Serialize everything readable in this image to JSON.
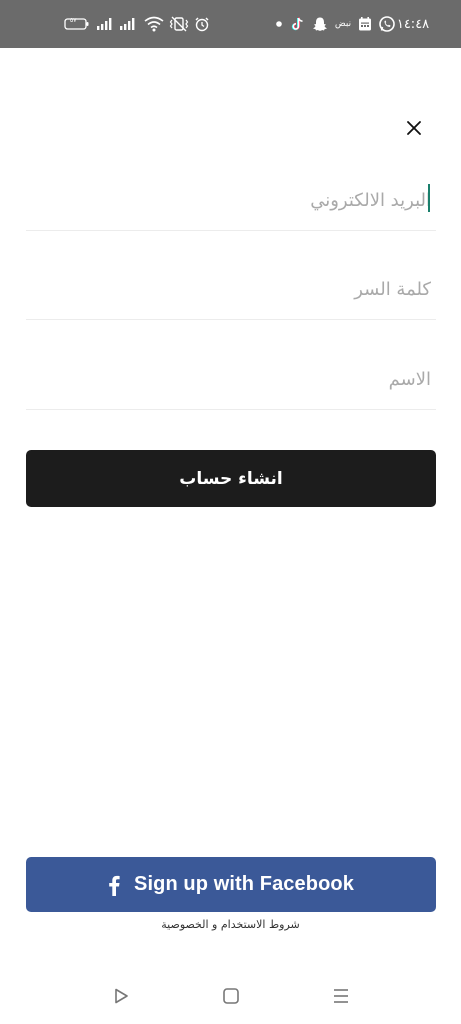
{
  "status_bar": {
    "time": "١٤:٤٨",
    "notification_text": "نبض",
    "battery_level": "٥٧",
    "icons": [
      "battery-icon",
      "signal-bars-icon",
      "signal-bars-icon",
      "wifi-icon",
      "vibrate-icon",
      "alarm-icon",
      "dot-icon",
      "tiktok-icon",
      "snapchat-icon",
      "nabd-icon",
      "calendar-icon",
      "whatsapp-icon"
    ]
  },
  "form": {
    "email_placeholder": "البريد الالكتروني",
    "password_placeholder": "كلمة السر",
    "name_placeholder": "الاسم",
    "create_account_label": "انشاء حساب"
  },
  "facebook": {
    "label": "Sign up with Facebook",
    "icon": "facebook-icon"
  },
  "terms_label": "شروط الاستخدام و الخصوصية",
  "nav": {
    "icons": [
      "back-icon",
      "home-icon",
      "menu-icon"
    ]
  },
  "colors": {
    "status_bar_bg": "#6b6b6b",
    "create_button_bg": "#1c1c1c",
    "facebook_bg": "#3b5998",
    "cursor": "#1a7f6c",
    "placeholder": "#a9a9a9"
  }
}
